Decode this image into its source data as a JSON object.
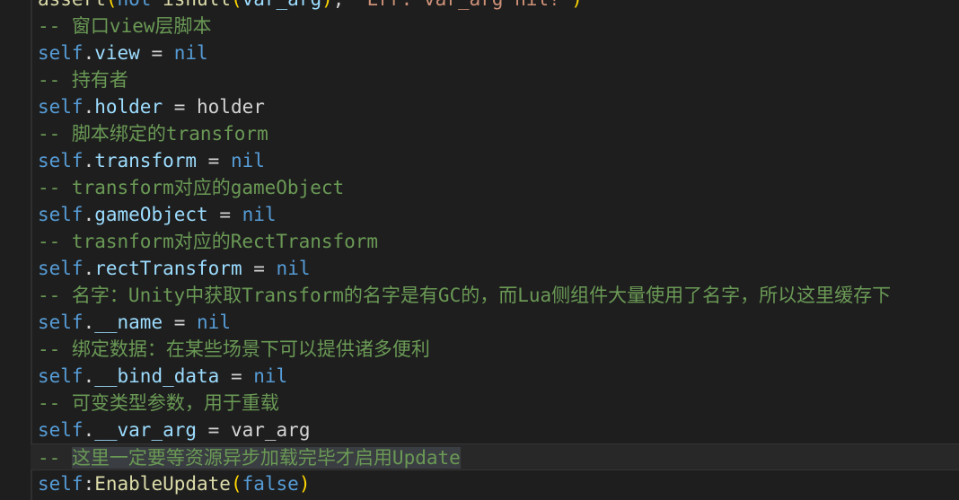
{
  "editor": {
    "lines": [
      {
        "id": "line-0",
        "parts": [
          {
            "cls": "fn",
            "text": "assert"
          },
          {
            "cls": "paren",
            "text": "("
          },
          {
            "cls": "kw",
            "text": "not "
          },
          {
            "cls": "fn",
            "text": "isnull"
          },
          {
            "cls": "paren",
            "text": "("
          },
          {
            "cls": "prop",
            "text": "var_arg"
          },
          {
            "cls": "paren",
            "text": ")"
          },
          {
            "cls": "plain",
            "text": ", "
          },
          {
            "cls": "str",
            "text": "\"Err: var_arg nil!\""
          },
          {
            "cls": "paren",
            "text": ")"
          }
        ]
      },
      {
        "id": "line-1",
        "parts": [
          {
            "cls": "comment",
            "text": "-- 窗口view层脚本"
          }
        ]
      },
      {
        "id": "line-2",
        "parts": [
          {
            "cls": "kw",
            "text": "self"
          },
          {
            "cls": "plain",
            "text": "."
          },
          {
            "cls": "prop",
            "text": "view"
          },
          {
            "cls": "plain",
            "text": " = "
          },
          {
            "cls": "kw",
            "text": "nil"
          }
        ]
      },
      {
        "id": "line-3",
        "parts": [
          {
            "cls": "comment",
            "text": "-- 持有者"
          }
        ]
      },
      {
        "id": "line-4",
        "parts": [
          {
            "cls": "kw",
            "text": "self"
          },
          {
            "cls": "plain",
            "text": "."
          },
          {
            "cls": "prop",
            "text": "holder"
          },
          {
            "cls": "plain",
            "text": " = holder"
          }
        ]
      },
      {
        "id": "line-5",
        "parts": [
          {
            "cls": "comment",
            "text": "-- 脚本绑定的transform"
          }
        ]
      },
      {
        "id": "line-6",
        "parts": [
          {
            "cls": "kw",
            "text": "self"
          },
          {
            "cls": "plain",
            "text": "."
          },
          {
            "cls": "prop",
            "text": "transform"
          },
          {
            "cls": "plain",
            "text": " = "
          },
          {
            "cls": "kw",
            "text": "nil"
          }
        ]
      },
      {
        "id": "line-7",
        "parts": [
          {
            "cls": "comment",
            "text": "-- transform对应的gameObject"
          }
        ]
      },
      {
        "id": "line-8",
        "parts": [
          {
            "cls": "kw",
            "text": "self"
          },
          {
            "cls": "plain",
            "text": "."
          },
          {
            "cls": "prop",
            "text": "gameObject"
          },
          {
            "cls": "plain",
            "text": " = "
          },
          {
            "cls": "kw",
            "text": "nil"
          }
        ]
      },
      {
        "id": "line-9",
        "parts": [
          {
            "cls": "comment",
            "text": "-- trasnform对应的RectTransform"
          }
        ]
      },
      {
        "id": "line-10",
        "parts": [
          {
            "cls": "kw",
            "text": "self"
          },
          {
            "cls": "plain",
            "text": "."
          },
          {
            "cls": "prop",
            "text": "rectTransform"
          },
          {
            "cls": "plain",
            "text": " = "
          },
          {
            "cls": "kw",
            "text": "nil"
          }
        ]
      },
      {
        "id": "line-11",
        "parts": [
          {
            "cls": "comment",
            "text": "-- 名字：Unity中获取Transform的名字是有GC的，而Lua侧组件大量使用了名字，所以这里缓存下"
          }
        ]
      },
      {
        "id": "line-12",
        "parts": [
          {
            "cls": "kw",
            "text": "self"
          },
          {
            "cls": "plain",
            "text": "."
          },
          {
            "cls": "prop",
            "text": "__name"
          },
          {
            "cls": "plain",
            "text": " = "
          },
          {
            "cls": "kw",
            "text": "nil"
          }
        ]
      },
      {
        "id": "line-13",
        "parts": [
          {
            "cls": "comment",
            "text": "-- 绑定数据：在某些场景下可以提供诸多便利"
          }
        ]
      },
      {
        "id": "line-14",
        "parts": [
          {
            "cls": "kw",
            "text": "self"
          },
          {
            "cls": "plain",
            "text": "."
          },
          {
            "cls": "prop",
            "text": "__bind_data"
          },
          {
            "cls": "plain",
            "text": " = "
          },
          {
            "cls": "kw",
            "text": "nil"
          }
        ]
      },
      {
        "id": "line-15",
        "parts": [
          {
            "cls": "comment",
            "text": "-- 可变类型参数，用于重载"
          }
        ]
      },
      {
        "id": "line-16",
        "parts": [
          {
            "cls": "kw",
            "text": "self"
          },
          {
            "cls": "plain",
            "text": "."
          },
          {
            "cls": "prop",
            "text": "__var_arg"
          },
          {
            "cls": "plain",
            "text": " = var_arg"
          }
        ]
      },
      {
        "id": "line-17",
        "current": true,
        "parts": [
          {
            "cls": "comment",
            "text": "-- "
          },
          {
            "cls": "comment selected-text",
            "text": "这里一定要等资源异步加载完毕才启用Update"
          }
        ]
      },
      {
        "id": "line-18",
        "parts": [
          {
            "cls": "kw",
            "text": "self"
          },
          {
            "cls": "plain",
            "text": ":"
          },
          {
            "cls": "fn",
            "text": "EnableUpdate"
          },
          {
            "cls": "paren",
            "text": "("
          },
          {
            "cls": "kw",
            "text": "false"
          },
          {
            "cls": "paren",
            "text": ")"
          }
        ]
      }
    ]
  }
}
